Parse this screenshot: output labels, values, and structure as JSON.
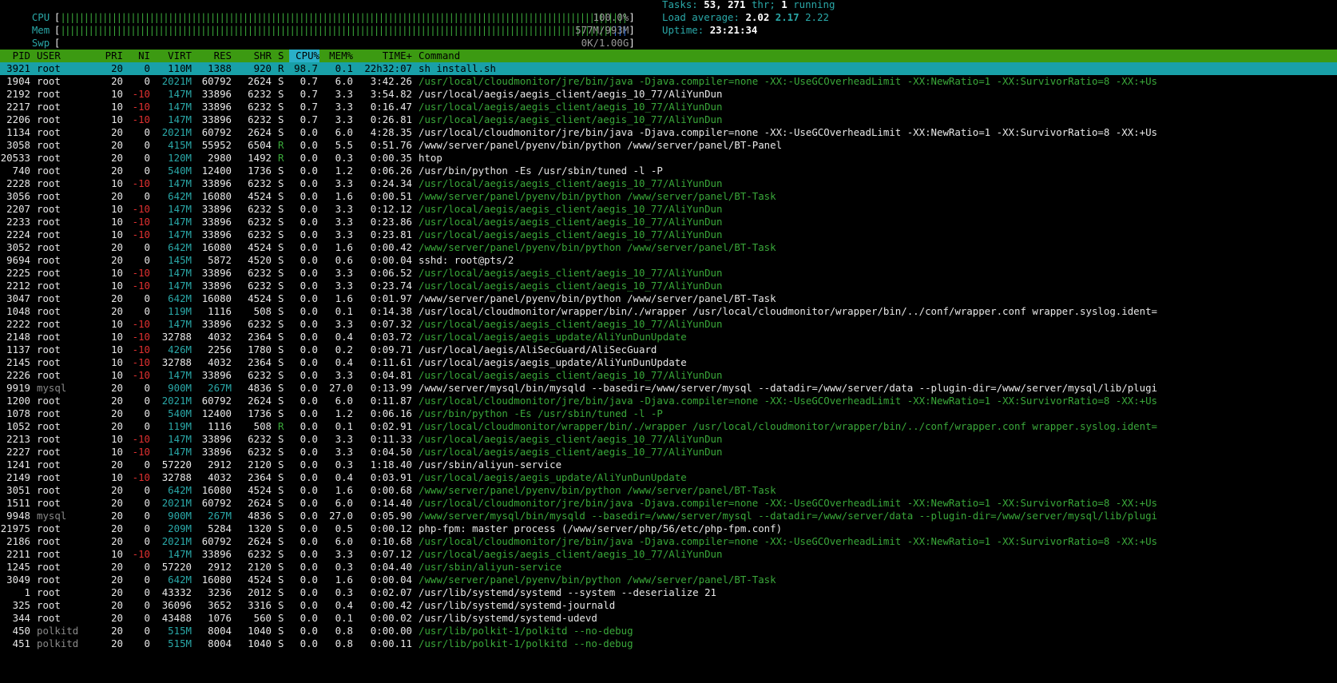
{
  "meters": {
    "cpu": {
      "label": "CPU",
      "value_text": "100.0%"
    },
    "mem": {
      "label": "Mem",
      "value_text": "577M/993M"
    },
    "swp": {
      "label": "Swp",
      "value_text": "0K/1.00G"
    }
  },
  "stats": {
    "tasks_label": "Tasks:",
    "tasks": "53,",
    "thr": "271",
    "thr_label": "thr;",
    "running": "1",
    "running_label": "running",
    "load_label": "Load average:",
    "load1": "2.02",
    "load5": "2.17",
    "load15": "2.22",
    "uptime_label": "Uptime:",
    "uptime": "23:21:34"
  },
  "columns": {
    "pid": "PID",
    "user": "USER",
    "pri": "PRI",
    "ni": "NI",
    "virt": "VIRT",
    "res": "RES",
    "shr": "SHR",
    "s": "S",
    "cpu": "CPU%",
    "mem": "MEM%",
    "time": "TIME+",
    "command": "Command"
  },
  "processes": [
    {
      "pid": "3921",
      "user": "root",
      "pri": "20",
      "ni": "0",
      "virt": "110M",
      "res": "1388",
      "shr": "920",
      "s": "R",
      "cpu": "98.7",
      "mem": "0.1",
      "time": "22h32:07",
      "cmd": "sh install.sh",
      "sel": true
    },
    {
      "pid": "1904",
      "user": "root",
      "pri": "20",
      "ni": "0",
      "virt": "2021M",
      "res": "60792",
      "shr": "2624",
      "s": "S",
      "cpu": "0.7",
      "mem": "6.0",
      "time": "3:42.26",
      "cmd": "/usr/local/cloudmonitor/jre/bin/java -Djava.compiler=none -XX:-UseGCOverheadLimit -XX:NewRatio=1 -XX:SurvivorRatio=8 -XX:+Us",
      "dim": true
    },
    {
      "pid": "2192",
      "user": "root",
      "pri": "10",
      "ni": "-10",
      "virt": "147M",
      "res": "33896",
      "shr": "6232",
      "s": "S",
      "cpu": "0.7",
      "mem": "3.3",
      "time": "3:54.82",
      "cmd": "/usr/local/aegis/aegis_client/aegis_10_77/AliYunDun"
    },
    {
      "pid": "2217",
      "user": "root",
      "pri": "10",
      "ni": "-10",
      "virt": "147M",
      "res": "33896",
      "shr": "6232",
      "s": "S",
      "cpu": "0.7",
      "mem": "3.3",
      "time": "0:16.47",
      "cmd": "/usr/local/aegis/aegis_client/aegis_10_77/AliYunDun",
      "dim": true
    },
    {
      "pid": "2206",
      "user": "root",
      "pri": "10",
      "ni": "-10",
      "virt": "147M",
      "res": "33896",
      "shr": "6232",
      "s": "S",
      "cpu": "0.7",
      "mem": "3.3",
      "time": "0:26.81",
      "cmd": "/usr/local/aegis/aegis_client/aegis_10_77/AliYunDun",
      "dim": true
    },
    {
      "pid": "1134",
      "user": "root",
      "pri": "20",
      "ni": "0",
      "virt": "2021M",
      "res": "60792",
      "shr": "2624",
      "s": "S",
      "cpu": "0.0",
      "mem": "6.0",
      "time": "4:28.35",
      "cmd": "/usr/local/cloudmonitor/jre/bin/java -Djava.compiler=none -XX:-UseGCOverheadLimit -XX:NewRatio=1 -XX:SurvivorRatio=8 -XX:+Us"
    },
    {
      "pid": "3058",
      "user": "root",
      "pri": "20",
      "ni": "0",
      "virt": "415M",
      "res": "55952",
      "shr": "6504",
      "s": "R",
      "cpu": "0.0",
      "mem": "5.5",
      "time": "0:51.76",
      "cmd": "/www/server/panel/pyenv/bin/python /www/server/panel/BT-Panel"
    },
    {
      "pid": "20533",
      "user": "root",
      "pri": "20",
      "ni": "0",
      "virt": "120M",
      "res": "2980",
      "shr": "1492",
      "s": "R",
      "cpu": "0.0",
      "mem": "0.3",
      "time": "0:00.35",
      "cmd": "htop"
    },
    {
      "pid": "740",
      "user": "root",
      "pri": "20",
      "ni": "0",
      "virt": "540M",
      "res": "12400",
      "shr": "1736",
      "s": "S",
      "cpu": "0.0",
      "mem": "1.2",
      "time": "0:06.26",
      "cmd": "/usr/bin/python -Es /usr/sbin/tuned -l -P"
    },
    {
      "pid": "2228",
      "user": "root",
      "pri": "10",
      "ni": "-10",
      "virt": "147M",
      "res": "33896",
      "shr": "6232",
      "s": "S",
      "cpu": "0.0",
      "mem": "3.3",
      "time": "0:24.34",
      "cmd": "/usr/local/aegis/aegis_client/aegis_10_77/AliYunDun",
      "dim": true
    },
    {
      "pid": "3056",
      "user": "root",
      "pri": "20",
      "ni": "0",
      "virt": "642M",
      "res": "16080",
      "shr": "4524",
      "s": "S",
      "cpu": "0.0",
      "mem": "1.6",
      "time": "0:00.51",
      "cmd": "/www/server/panel/pyenv/bin/python /www/server/panel/BT-Task",
      "dim": true
    },
    {
      "pid": "2207",
      "user": "root",
      "pri": "10",
      "ni": "-10",
      "virt": "147M",
      "res": "33896",
      "shr": "6232",
      "s": "S",
      "cpu": "0.0",
      "mem": "3.3",
      "time": "0:12.12",
      "cmd": "/usr/local/aegis/aegis_client/aegis_10_77/AliYunDun",
      "dim": true
    },
    {
      "pid": "2233",
      "user": "root",
      "pri": "10",
      "ni": "-10",
      "virt": "147M",
      "res": "33896",
      "shr": "6232",
      "s": "S",
      "cpu": "0.0",
      "mem": "3.3",
      "time": "0:23.86",
      "cmd": "/usr/local/aegis/aegis_client/aegis_10_77/AliYunDun",
      "dim": true
    },
    {
      "pid": "2224",
      "user": "root",
      "pri": "10",
      "ni": "-10",
      "virt": "147M",
      "res": "33896",
      "shr": "6232",
      "s": "S",
      "cpu": "0.0",
      "mem": "3.3",
      "time": "0:23.81",
      "cmd": "/usr/local/aegis/aegis_client/aegis_10_77/AliYunDun",
      "dim": true
    },
    {
      "pid": "3052",
      "user": "root",
      "pri": "20",
      "ni": "0",
      "virt": "642M",
      "res": "16080",
      "shr": "4524",
      "s": "S",
      "cpu": "0.0",
      "mem": "1.6",
      "time": "0:00.42",
      "cmd": "/www/server/panel/pyenv/bin/python /www/server/panel/BT-Task",
      "dim": true
    },
    {
      "pid": "9694",
      "user": "root",
      "pri": "20",
      "ni": "0",
      "virt": "145M",
      "res": "5872",
      "shr": "4520",
      "s": "S",
      "cpu": "0.0",
      "mem": "0.6",
      "time": "0:00.04",
      "cmd": "sshd: root@pts/2"
    },
    {
      "pid": "2225",
      "user": "root",
      "pri": "10",
      "ni": "-10",
      "virt": "147M",
      "res": "33896",
      "shr": "6232",
      "s": "S",
      "cpu": "0.0",
      "mem": "3.3",
      "time": "0:06.52",
      "cmd": "/usr/local/aegis/aegis_client/aegis_10_77/AliYunDun",
      "dim": true
    },
    {
      "pid": "2212",
      "user": "root",
      "pri": "10",
      "ni": "-10",
      "virt": "147M",
      "res": "33896",
      "shr": "6232",
      "s": "S",
      "cpu": "0.0",
      "mem": "3.3",
      "time": "0:23.74",
      "cmd": "/usr/local/aegis/aegis_client/aegis_10_77/AliYunDun",
      "dim": true
    },
    {
      "pid": "3047",
      "user": "root",
      "pri": "20",
      "ni": "0",
      "virt": "642M",
      "res": "16080",
      "shr": "4524",
      "s": "S",
      "cpu": "0.0",
      "mem": "1.6",
      "time": "0:01.97",
      "cmd": "/www/server/panel/pyenv/bin/python /www/server/panel/BT-Task"
    },
    {
      "pid": "1048",
      "user": "root",
      "pri": "20",
      "ni": "0",
      "virt": "119M",
      "res": "1116",
      "shr": "508",
      "s": "S",
      "cpu": "0.0",
      "mem": "0.1",
      "time": "0:14.38",
      "cmd": "/usr/local/cloudmonitor/wrapper/bin/./wrapper /usr/local/cloudmonitor/wrapper/bin/../conf/wrapper.conf wrapper.syslog.ident="
    },
    {
      "pid": "2222",
      "user": "root",
      "pri": "10",
      "ni": "-10",
      "virt": "147M",
      "res": "33896",
      "shr": "6232",
      "s": "S",
      "cpu": "0.0",
      "mem": "3.3",
      "time": "0:07.32",
      "cmd": "/usr/local/aegis/aegis_client/aegis_10_77/AliYunDun",
      "dim": true
    },
    {
      "pid": "2148",
      "user": "root",
      "pri": "10",
      "ni": "-10",
      "virt": "32788",
      "res": "4032",
      "shr": "2364",
      "s": "S",
      "cpu": "0.0",
      "mem": "0.4",
      "time": "0:03.72",
      "cmd": "/usr/local/aegis/aegis_update/AliYunDunUpdate",
      "dim": true
    },
    {
      "pid": "1137",
      "user": "root",
      "pri": "10",
      "ni": "-10",
      "virt": "426M",
      "res": "2256",
      "shr": "1780",
      "s": "S",
      "cpu": "0.0",
      "mem": "0.2",
      "time": "0:09.71",
      "cmd": "/usr/local/aegis/AliSecGuard/AliSecGuard"
    },
    {
      "pid": "2145",
      "user": "root",
      "pri": "10",
      "ni": "-10",
      "virt": "32788",
      "res": "4032",
      "shr": "2364",
      "s": "S",
      "cpu": "0.0",
      "mem": "0.4",
      "time": "0:11.61",
      "cmd": "/usr/local/aegis/aegis_update/AliYunDunUpdate"
    },
    {
      "pid": "2226",
      "user": "root",
      "pri": "10",
      "ni": "-10",
      "virt": "147M",
      "res": "33896",
      "shr": "6232",
      "s": "S",
      "cpu": "0.0",
      "mem": "3.3",
      "time": "0:04.81",
      "cmd": "/usr/local/aegis/aegis_client/aegis_10_77/AliYunDun",
      "dim": true
    },
    {
      "pid": "9919",
      "user": "mysql",
      "pri": "20",
      "ni": "0",
      "virt": "900M",
      "res": "267M",
      "shr": "4836",
      "s": "S",
      "cpu": "0.0",
      "mem": "27.0",
      "time": "0:13.99",
      "cmd": "/www/server/mysql/bin/mysqld --basedir=/www/server/mysql --datadir=/www/server/data --plugin-dir=/www/server/mysql/lib/plugi",
      "udim": true
    },
    {
      "pid": "1200",
      "user": "root",
      "pri": "20",
      "ni": "0",
      "virt": "2021M",
      "res": "60792",
      "shr": "2624",
      "s": "S",
      "cpu": "0.0",
      "mem": "6.0",
      "time": "0:11.87",
      "cmd": "/usr/local/cloudmonitor/jre/bin/java -Djava.compiler=none -XX:-UseGCOverheadLimit -XX:NewRatio=1 -XX:SurvivorRatio=8 -XX:+Us",
      "dim": true
    },
    {
      "pid": "1078",
      "user": "root",
      "pri": "20",
      "ni": "0",
      "virt": "540M",
      "res": "12400",
      "shr": "1736",
      "s": "S",
      "cpu": "0.0",
      "mem": "1.2",
      "time": "0:06.16",
      "cmd": "/usr/bin/python -Es /usr/sbin/tuned -l -P",
      "dim": true
    },
    {
      "pid": "1052",
      "user": "root",
      "pri": "20",
      "ni": "0",
      "virt": "119M",
      "res": "1116",
      "shr": "508",
      "s": "R",
      "cpu": "0.0",
      "mem": "0.1",
      "time": "0:02.91",
      "cmd": "/usr/local/cloudmonitor/wrapper/bin/./wrapper /usr/local/cloudmonitor/wrapper/bin/../conf/wrapper.conf wrapper.syslog.ident=",
      "dim": true
    },
    {
      "pid": "2213",
      "user": "root",
      "pri": "10",
      "ni": "-10",
      "virt": "147M",
      "res": "33896",
      "shr": "6232",
      "s": "S",
      "cpu": "0.0",
      "mem": "3.3",
      "time": "0:11.33",
      "cmd": "/usr/local/aegis/aegis_client/aegis_10_77/AliYunDun",
      "dim": true
    },
    {
      "pid": "2227",
      "user": "root",
      "pri": "10",
      "ni": "-10",
      "virt": "147M",
      "res": "33896",
      "shr": "6232",
      "s": "S",
      "cpu": "0.0",
      "mem": "3.3",
      "time": "0:04.50",
      "cmd": "/usr/local/aegis/aegis_client/aegis_10_77/AliYunDun",
      "dim": true
    },
    {
      "pid": "1241",
      "user": "root",
      "pri": "20",
      "ni": "0",
      "virt": "57220",
      "res": "2912",
      "shr": "2120",
      "s": "S",
      "cpu": "0.0",
      "mem": "0.3",
      "time": "1:18.40",
      "cmd": "/usr/sbin/aliyun-service"
    },
    {
      "pid": "2149",
      "user": "root",
      "pri": "10",
      "ni": "-10",
      "virt": "32788",
      "res": "4032",
      "shr": "2364",
      "s": "S",
      "cpu": "0.0",
      "mem": "0.4",
      "time": "0:03.91",
      "cmd": "/usr/local/aegis/aegis_update/AliYunDunUpdate",
      "dim": true
    },
    {
      "pid": "3051",
      "user": "root",
      "pri": "20",
      "ni": "0",
      "virt": "642M",
      "res": "16080",
      "shr": "4524",
      "s": "S",
      "cpu": "0.0",
      "mem": "1.6",
      "time": "0:00.68",
      "cmd": "/www/server/panel/pyenv/bin/python /www/server/panel/BT-Task",
      "dim": true
    },
    {
      "pid": "1511",
      "user": "root",
      "pri": "20",
      "ni": "0",
      "virt": "2021M",
      "res": "60792",
      "shr": "2624",
      "s": "S",
      "cpu": "0.0",
      "mem": "6.0",
      "time": "0:14.40",
      "cmd": "/usr/local/cloudmonitor/jre/bin/java -Djava.compiler=none -XX:-UseGCOverheadLimit -XX:NewRatio=1 -XX:SurvivorRatio=8 -XX:+Us",
      "dim": true
    },
    {
      "pid": "9948",
      "user": "mysql",
      "pri": "20",
      "ni": "0",
      "virt": "900M",
      "res": "267M",
      "shr": "4836",
      "s": "S",
      "cpu": "0.0",
      "mem": "27.0",
      "time": "0:05.90",
      "cmd": "/www/server/mysql/bin/mysqld --basedir=/www/server/mysql --datadir=/www/server/data --plugin-dir=/www/server/mysql/lib/plugi",
      "dim": true,
      "udim": true
    },
    {
      "pid": "21975",
      "user": "root",
      "pri": "20",
      "ni": "0",
      "virt": "209M",
      "res": "5284",
      "shr": "1320",
      "s": "S",
      "cpu": "0.0",
      "mem": "0.5",
      "time": "0:00.12",
      "cmd": "php-fpm: master process (/www/server/php/56/etc/php-fpm.conf)"
    },
    {
      "pid": "2186",
      "user": "root",
      "pri": "20",
      "ni": "0",
      "virt": "2021M",
      "res": "60792",
      "shr": "2624",
      "s": "S",
      "cpu": "0.0",
      "mem": "6.0",
      "time": "0:10.68",
      "cmd": "/usr/local/cloudmonitor/jre/bin/java -Djava.compiler=none -XX:-UseGCOverheadLimit -XX:NewRatio=1 -XX:SurvivorRatio=8 -XX:+Us",
      "dim": true
    },
    {
      "pid": "2211",
      "user": "root",
      "pri": "10",
      "ni": "-10",
      "virt": "147M",
      "res": "33896",
      "shr": "6232",
      "s": "S",
      "cpu": "0.0",
      "mem": "3.3",
      "time": "0:07.12",
      "cmd": "/usr/local/aegis/aegis_client/aegis_10_77/AliYunDun",
      "dim": true
    },
    {
      "pid": "1245",
      "user": "root",
      "pri": "20",
      "ni": "0",
      "virt": "57220",
      "res": "2912",
      "shr": "2120",
      "s": "S",
      "cpu": "0.0",
      "mem": "0.3",
      "time": "0:04.40",
      "cmd": "/usr/sbin/aliyun-service",
      "dim": true
    },
    {
      "pid": "3049",
      "user": "root",
      "pri": "20",
      "ni": "0",
      "virt": "642M",
      "res": "16080",
      "shr": "4524",
      "s": "S",
      "cpu": "0.0",
      "mem": "1.6",
      "time": "0:00.04",
      "cmd": "/www/server/panel/pyenv/bin/python /www/server/panel/BT-Task",
      "dim": true
    },
    {
      "pid": "1",
      "user": "root",
      "pri": "20",
      "ni": "0",
      "virt": "43332",
      "res": "3236",
      "shr": "2012",
      "s": "S",
      "cpu": "0.0",
      "mem": "0.3",
      "time": "0:02.07",
      "cmd": "/usr/lib/systemd/systemd --system --deserialize 21"
    },
    {
      "pid": "325",
      "user": "root",
      "pri": "20",
      "ni": "0",
      "virt": "36096",
      "res": "3652",
      "shr": "3316",
      "s": "S",
      "cpu": "0.0",
      "mem": "0.4",
      "time": "0:00.42",
      "cmd": "/usr/lib/systemd/systemd-journald"
    },
    {
      "pid": "344",
      "user": "root",
      "pri": "20",
      "ni": "0",
      "virt": "43488",
      "res": "1076",
      "shr": "560",
      "s": "S",
      "cpu": "0.0",
      "mem": "0.1",
      "time": "0:00.02",
      "cmd": "/usr/lib/systemd/systemd-udevd"
    },
    {
      "pid": "450",
      "user": "polkitd",
      "pri": "20",
      "ni": "0",
      "virt": "515M",
      "res": "8004",
      "shr": "1040",
      "s": "S",
      "cpu": "0.0",
      "mem": "0.8",
      "time": "0:00.00",
      "cmd": "/usr/lib/polkit-1/polkitd --no-debug",
      "dim": true,
      "udim": true
    },
    {
      "pid": "451",
      "user": "polkitd",
      "pri": "20",
      "ni": "0",
      "virt": "515M",
      "res": "8004",
      "shr": "1040",
      "s": "S",
      "cpu": "0.0",
      "mem": "0.8",
      "time": "0:00.11",
      "cmd": "/usr/lib/polkit-1/polkitd --no-debug",
      "dim": true,
      "udim": true
    }
  ],
  "colors": {
    "header_bg": "#3c9a12",
    "selected_bg": "#19a0a8",
    "kernel_thread": "#3aa83a",
    "negative_nice": "#e03030",
    "label": "#2aa8a8"
  }
}
